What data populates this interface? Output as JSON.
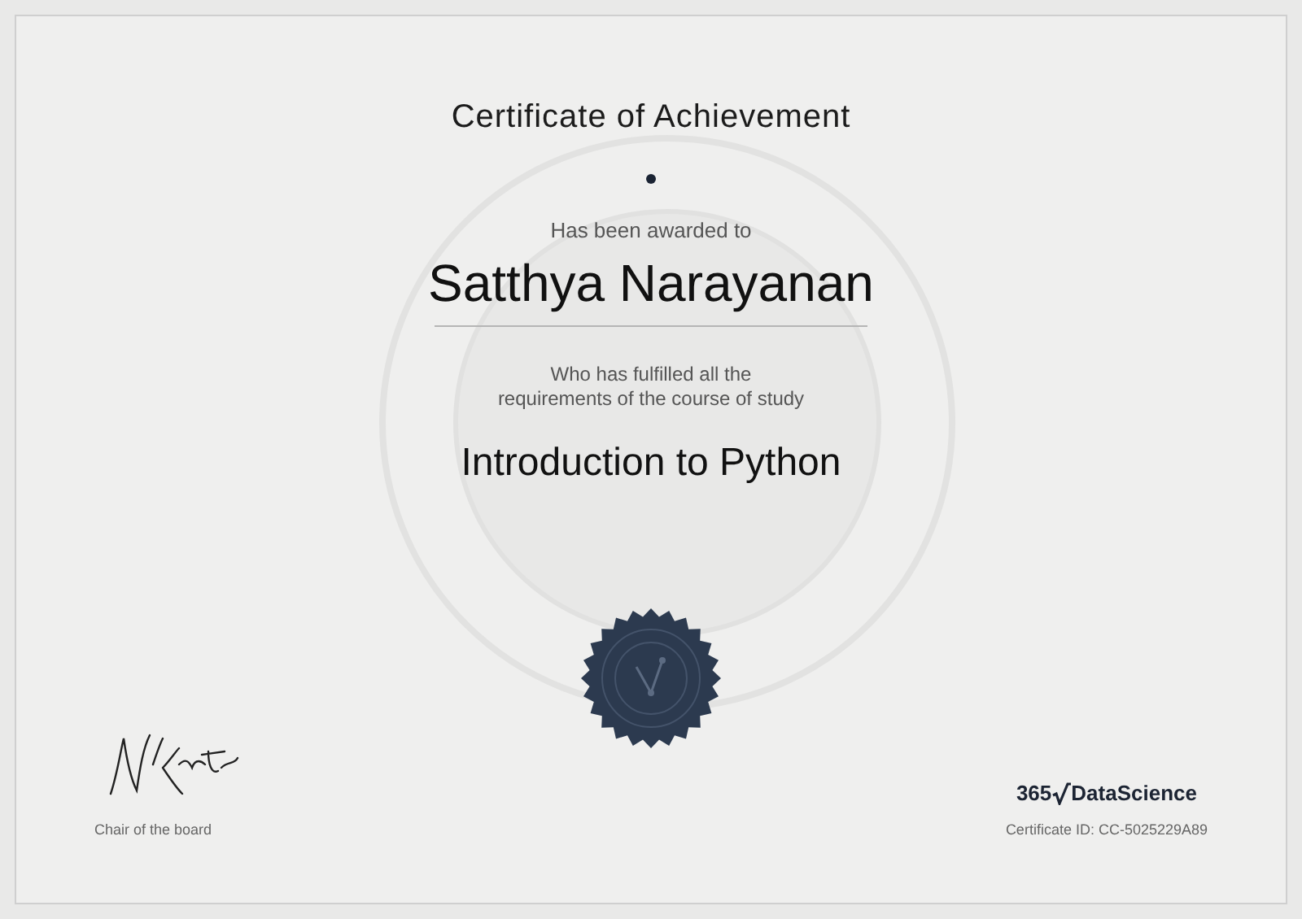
{
  "certificate": {
    "title": "Certificate of Achievement",
    "awarded_label": "Has been awarded to",
    "recipient": "Satthya Narayanan",
    "requirement_lines": [
      "Who has fulfilled all the",
      "requirements of the course of study"
    ],
    "course": "Introduction to Python"
  },
  "signature": {
    "role": "Chair of the board"
  },
  "logo": {
    "number": "365",
    "name": "DataScience"
  },
  "certificate_id": "Certificate ID: CC-5025229A89"
}
